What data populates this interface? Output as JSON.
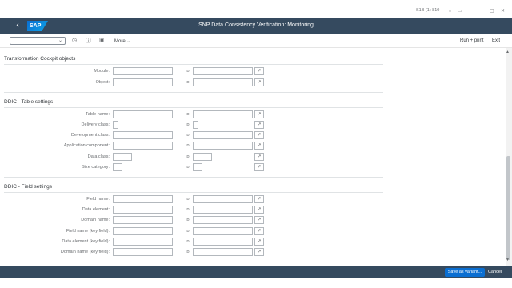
{
  "system": {
    "info": "S1B (1) 810"
  },
  "header": {
    "title": "SNP Data Consistency Verification: Monitoring",
    "logo": "SAP"
  },
  "toolbar": {
    "more_label": "More",
    "run_label": "Run + print",
    "exit_label": "Exit"
  },
  "to_label": "to:",
  "sections": {
    "cockpit": {
      "title": "Transformation Cockpit objects",
      "fields": [
        {
          "label": "Module:"
        },
        {
          "label": "Object:"
        }
      ]
    },
    "ddic_table": {
      "title": "DDIC - Table settings",
      "fields": [
        {
          "label": "Table name:"
        },
        {
          "label": "Delivery class:"
        },
        {
          "label": "Development class:"
        },
        {
          "label": "Application component:"
        },
        {
          "label": "Data class:"
        },
        {
          "label": "Size category:"
        }
      ]
    },
    "ddic_field": {
      "title": "DDIC - Field settings",
      "fields": [
        {
          "label": "Field name:"
        },
        {
          "label": "Data element:"
        },
        {
          "label": "Domain name:"
        },
        {
          "label": "Field name (key field):"
        },
        {
          "label": "Data element (key field):"
        },
        {
          "label": "Domain name (key field):"
        }
      ]
    }
  },
  "footer": {
    "save_label": "Save as variant...",
    "cancel_label": "Cancel"
  },
  "colors": {
    "shell": "#354a5f",
    "primary": "#0a6ed1"
  }
}
